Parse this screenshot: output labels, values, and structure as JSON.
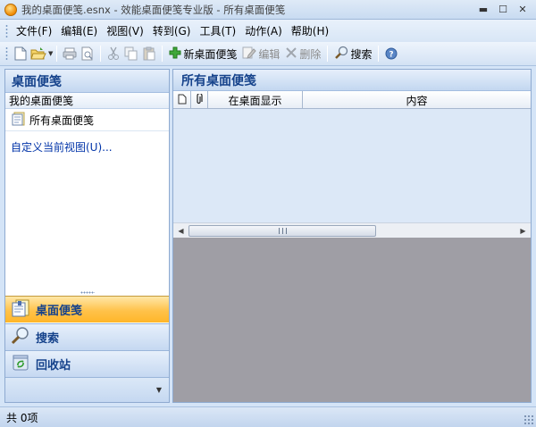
{
  "window": {
    "title": "我的桌面便笺.esnx - 效能桌面便笺专业版 - 所有桌面便笺",
    "minimize": "▬",
    "maximize": "☐",
    "close": "✕"
  },
  "menu": {
    "items": [
      "文件(F)",
      "编辑(E)",
      "视图(V)",
      "转到(G)",
      "工具(T)",
      "动作(A)",
      "帮助(H)"
    ]
  },
  "toolbar": {
    "new_note": "新桌面便笺",
    "edit": "编辑",
    "delete": "删除",
    "search": "搜索"
  },
  "left_pane": {
    "header": "桌面便笺",
    "group_title": "我的桌面便笺",
    "all_notes": "所有桌面便笺",
    "custom_view": "自定义当前视图(U)..."
  },
  "nav_buttons": {
    "notes": "桌面便笺",
    "search": "搜索",
    "recycle": "回收站"
  },
  "right_pane": {
    "header": "所有桌面便笺",
    "columns": {
      "show_on_desktop": "在桌面显示",
      "content": "内容"
    }
  },
  "status": {
    "count_text": "共 0项"
  },
  "colors": {
    "accent": "#15428b",
    "active_nav": "#ffc24a",
    "empty_area": "#9f9ea5"
  }
}
